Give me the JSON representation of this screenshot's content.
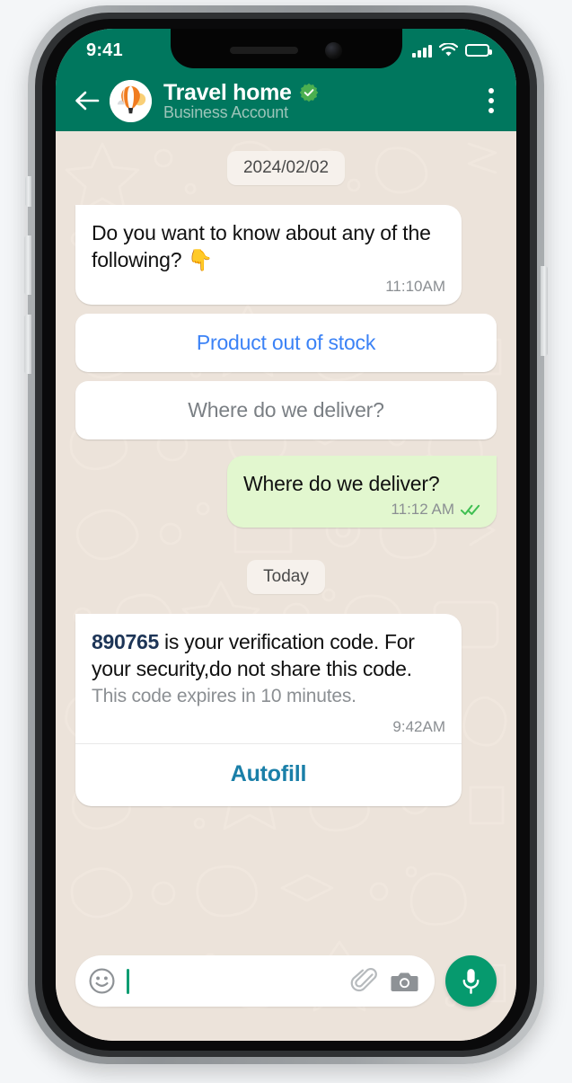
{
  "statusbar": {
    "time": "9:41",
    "signal_icon": "cellular-signal-icon",
    "wifi_icon": "wifi-icon",
    "battery_icon": "battery-icon"
  },
  "header": {
    "back_icon": "back-arrow-icon",
    "avatar_icon": "hot-air-balloon-avatar",
    "title": "Travel home",
    "verified_icon": "verified-badge-icon",
    "subtitle": "Business Account",
    "menu_icon": "overflow-menu-icon"
  },
  "chat": {
    "date_chips": {
      "first": "2024/02/02",
      "second": "Today"
    },
    "messages": [
      {
        "id": "intro",
        "direction": "incoming",
        "text": "Do you want to know about any of the following? 👇",
        "time": "11:10AM"
      },
      {
        "id": "reply-echo",
        "direction": "outgoing",
        "text": "Where do we deliver?",
        "time": "11:12 AM",
        "status_icon": "double-check-read-icon"
      }
    ],
    "quick_replies": [
      {
        "label": "Product out of stock",
        "style": "blue"
      },
      {
        "label": "Where do we deliver?",
        "style": "grey"
      }
    ],
    "verification": {
      "code": "890765",
      "text_after_code": " is your verification code. For your security,do not share this code.",
      "expiry": "This code expires in 10 minutes.",
      "time": "9:42AM",
      "action_label": "Autofill"
    }
  },
  "composer": {
    "emoji_icon": "emoji-smiley-icon",
    "value": "",
    "placeholder": "",
    "attach_icon": "paperclip-icon",
    "camera_icon": "camera-icon",
    "mic_icon": "microphone-icon"
  },
  "colors": {
    "header_green": "#00775e",
    "outgoing_bubble": "#e2f7cf",
    "chat_background": "#ece3da",
    "quick_reply_blue": "#3b82f6",
    "quick_reply_grey": "#7a7f84",
    "autofill_blue": "#1a7fa8",
    "code_navy": "#1d3557",
    "mic_green": "#069a6e",
    "read_tick_green": "#3fbf52"
  }
}
